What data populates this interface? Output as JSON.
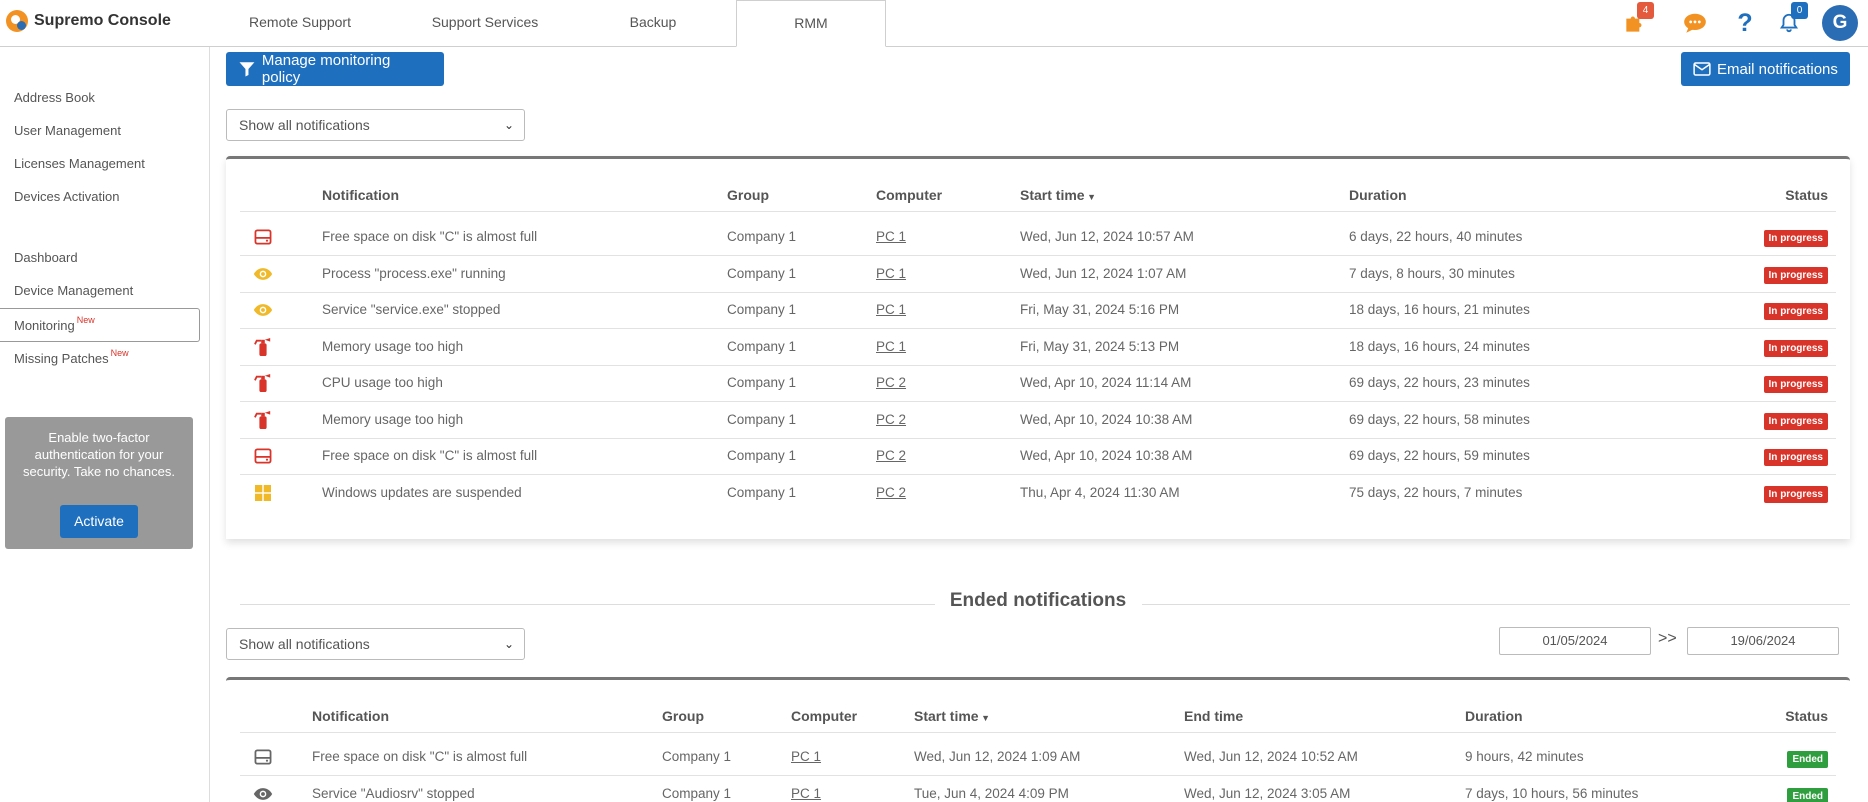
{
  "brand": {
    "name": "Supremo Console"
  },
  "tabs": [
    "Remote Support",
    "Support Services",
    "Backup",
    "RMM"
  ],
  "top_icons": {
    "puzzle_badge": "4",
    "bell_badge": "0",
    "avatar_initial": "G"
  },
  "sidebar": {
    "group1": [
      "Address Book",
      "User Management",
      "Licenses Management",
      "Devices Activation"
    ],
    "group2": [
      {
        "label": "Dashboard",
        "tag": ""
      },
      {
        "label": "Device Management",
        "tag": ""
      },
      {
        "label": "Monitoring",
        "tag": "New"
      },
      {
        "label": "Missing Patches",
        "tag": "New"
      }
    ],
    "twofa_text": "Enable two-factor authentication for your security. Take no chances.",
    "twofa_button": "Activate"
  },
  "toolbar": {
    "manage_policy": "Manage monitoring policy",
    "email_notifications": "Email notifications"
  },
  "active": {
    "filter": "Show all notifications",
    "headers": {
      "notification": "Notification",
      "group": "Group",
      "computer": "Computer",
      "start": "Start time",
      "duration": "Duration",
      "status": "Status"
    },
    "rows": [
      {
        "icon": "disk-icon",
        "color": "#d9342a",
        "notification": "Free space on disk \"C\" is almost full",
        "group": "Company 1",
        "computer": "PC 1",
        "start": "Wed, Jun 12, 2024 10:57 AM",
        "duration": "6 days, 22 hours, 40 minutes",
        "status": "In progress"
      },
      {
        "icon": "eye-icon",
        "color": "#f0b92a",
        "notification": "Process \"process.exe\" running",
        "group": "Company 1",
        "computer": "PC 1",
        "start": "Wed, Jun 12, 2024 1:07 AM",
        "duration": "7 days, 8 hours, 30 minutes",
        "status": "In progress"
      },
      {
        "icon": "eye-icon",
        "color": "#f0b92a",
        "notification": "Service \"service.exe\" stopped",
        "group": "Company 1",
        "computer": "PC 1",
        "start": "Fri, May 31, 2024 5:16 PM",
        "duration": "18 days, 16 hours, 21 minutes",
        "status": "In progress"
      },
      {
        "icon": "extinguisher-icon",
        "color": "#d9342a",
        "notification": "Memory usage too high",
        "group": "Company 1",
        "computer": "PC 1",
        "start": "Fri, May 31, 2024 5:13 PM",
        "duration": "18 days, 16 hours, 24 minutes",
        "status": "In progress"
      },
      {
        "icon": "extinguisher-icon",
        "color": "#d9342a",
        "notification": "CPU usage too high",
        "group": "Company 1",
        "computer": "PC 2",
        "start": "Wed, Apr 10, 2024 11:14 AM",
        "duration": "69 days, 22 hours, 23 minutes",
        "status": "In progress"
      },
      {
        "icon": "extinguisher-icon",
        "color": "#d9342a",
        "notification": "Memory usage too high",
        "group": "Company 1",
        "computer": "PC 2",
        "start": "Wed, Apr 10, 2024 10:38 AM",
        "duration": "69 days, 22 hours, 58 minutes",
        "status": "In progress"
      },
      {
        "icon": "disk-icon",
        "color": "#d9342a",
        "notification": "Free space on disk \"C\" is almost full",
        "group": "Company 1",
        "computer": "PC 2",
        "start": "Wed, Apr 10, 2024 10:38 AM",
        "duration": "69 days, 22 hours, 59 minutes",
        "status": "In progress"
      },
      {
        "icon": "windows-icon",
        "color": "#f0b92a",
        "notification": "Windows updates are suspended",
        "group": "Company 1",
        "computer": "PC 2",
        "start": "Thu, Apr 4, 2024 11:30 AM",
        "duration": "75 days, 22 hours, 7 minutes",
        "status": "In progress"
      }
    ]
  },
  "ended": {
    "title": "Ended notifications",
    "filter": "Show all notifications",
    "date_from": "01/05/2024",
    "date_sep": ">>",
    "date_to": "19/06/2024",
    "headers": {
      "notification": "Notification",
      "group": "Group",
      "computer": "Computer",
      "start": "Start time",
      "end": "End time",
      "duration": "Duration",
      "status": "Status"
    },
    "rows": [
      {
        "icon": "disk-icon",
        "color": "#666666",
        "notification": "Free space on disk \"C\" is almost full",
        "group": "Company 1",
        "computer": "PC 1",
        "start": "Wed, Jun 12, 2024 1:09 AM",
        "end": "Wed, Jun 12, 2024 10:52 AM",
        "duration": "9 hours, 42 minutes",
        "status": "Ended"
      },
      {
        "icon": "eye-icon",
        "color": "#666666",
        "notification": "Service \"Audiosrv\" stopped",
        "group": "Company 1",
        "computer": "PC 1",
        "start": "Tue, Jun 4, 2024 4:09 PM",
        "end": "Wed, Jun 12, 2024 3:05 AM",
        "duration": "7 days, 10 hours, 56 minutes",
        "status": "Ended"
      }
    ]
  },
  "colors": {
    "primary": "#1f6fbf",
    "in_progress": "#d9342a",
    "ended": "#2e9e3e",
    "warning": "#f0b92a",
    "orange": "#f29223"
  }
}
